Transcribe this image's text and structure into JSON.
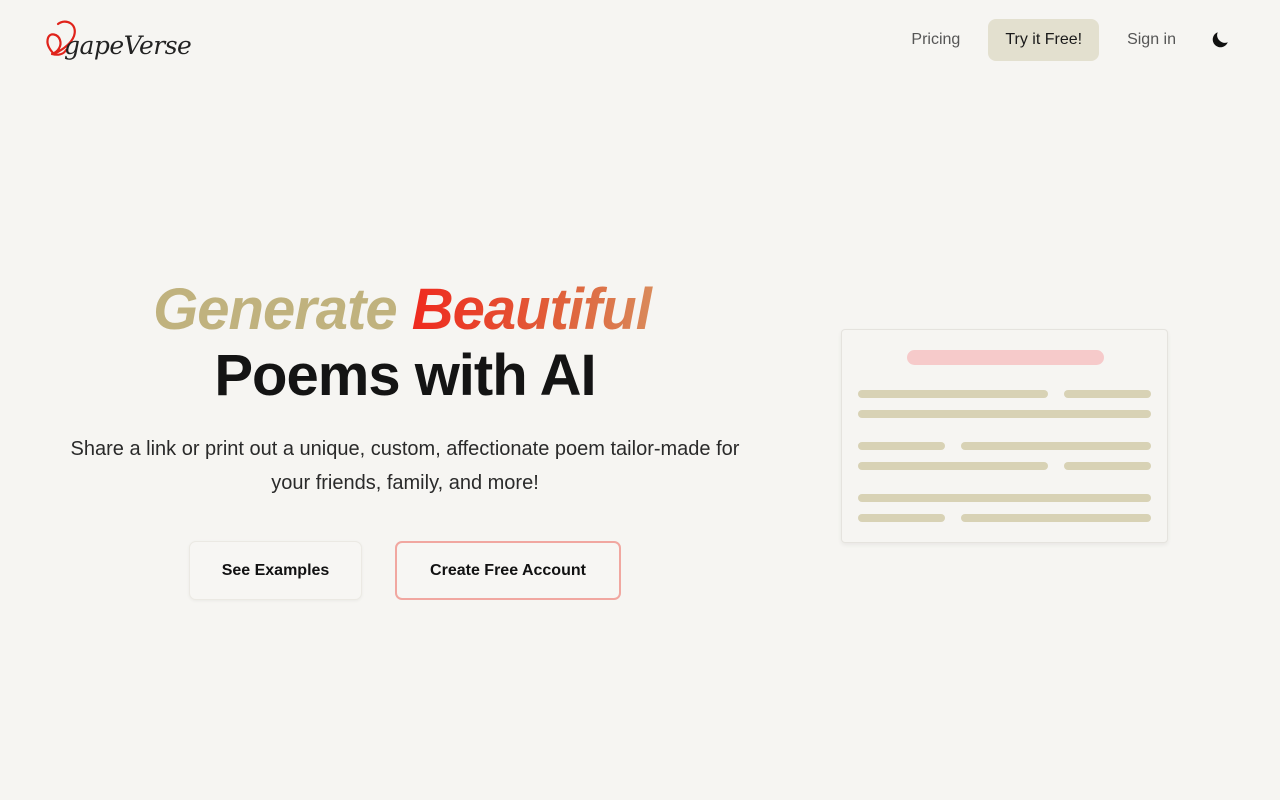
{
  "header": {
    "logo_text": "gapeVerse",
    "nav": {
      "pricing": "Pricing",
      "try_free": "Try it Free!",
      "sign_in": "Sign in"
    },
    "theme_icon": "moon-icon"
  },
  "hero": {
    "title_word1": "Generate",
    "title_word2": "Beautiful",
    "title_line2": "Poems with AI",
    "subtitle": "Share a link or print out a unique, custom, affectionate poem tailor-made for your friends, family, and more!",
    "btn_examples": "See Examples",
    "btn_create": "Create Free Account"
  },
  "colors": {
    "accent_gold": "#c0b27e",
    "accent_red": "#ef2a1f",
    "cta_bg": "#e3e0cf",
    "poem_line": "#d8d2b5",
    "poem_title": "#f6caca"
  }
}
